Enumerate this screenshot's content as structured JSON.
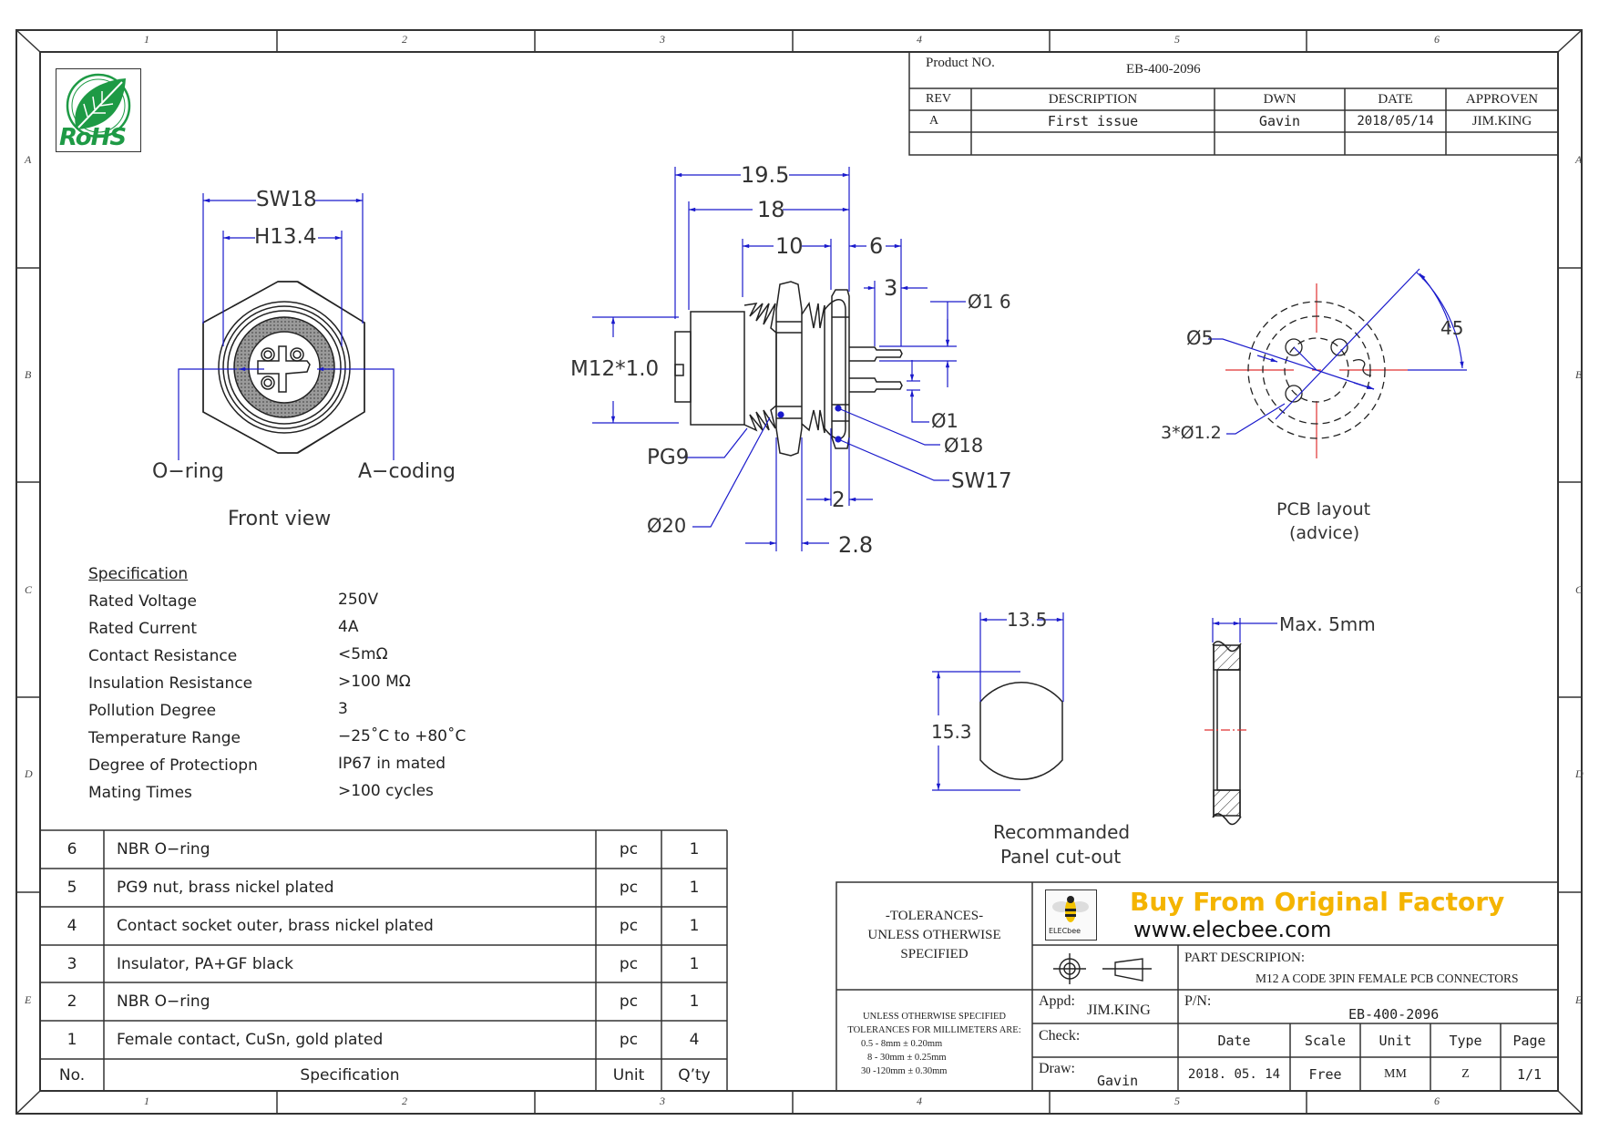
{
  "sheet": {
    "zones_top": [
      "1",
      "2",
      "3",
      "4",
      "5",
      "6"
    ],
    "zones_bottom": [
      "1",
      "2",
      "3",
      "4",
      "5",
      "6"
    ],
    "zones_left": [
      "A",
      "B",
      "C",
      "D",
      "E"
    ],
    "zones_right": [
      "A",
      "B",
      "C",
      "D",
      "E"
    ]
  },
  "logo": {
    "rohs_text": "RoHS",
    "icon": "rohs-leaf-icon"
  },
  "revision_block": {
    "product_no_label": "Product NO.",
    "product_no": "EB-400-2096",
    "headers": [
      "REV",
      "DESCRIPTION",
      "DWN",
      "DATE",
      "APPROVEN"
    ],
    "rows": [
      [
        "A",
        "First issue",
        "Gavin",
        "2018/05/14",
        "JIM.KING"
      ]
    ]
  },
  "front_view": {
    "dim_sw": "SW18",
    "dim_h": "H13.4",
    "label_oring": "O−ring",
    "label_coding": "A−coding",
    "caption": "Front  view"
  },
  "side_view": {
    "dim_overall": "19.5",
    "dim_body": "18",
    "dim_thread": "10",
    "dim_pins": "6",
    "dim_pin_tip": "3",
    "dim_pin_pitch": "Ø1 6",
    "dim_pin_dia": "Ø1",
    "dim_flange": "Ø18",
    "dim_sw": "SW17",
    "dim_thread_spec": "M12*1.0",
    "dim_pg": "PG9",
    "dim_nut_dia": "Ø20",
    "dim_flange_thk": "2",
    "dim_nut_thk": "2.8"
  },
  "pcb_layout": {
    "dim_circle": "Ø5",
    "dim_holes": "3*Ø1.2",
    "dim_angle": "45",
    "caption_1": "PCB layout",
    "caption_2": "(advice)"
  },
  "panel_cutout": {
    "dim_width": "13.5",
    "dim_height": "15.3",
    "caption_1": "Recommanded",
    "caption_2": "Panel cut-out",
    "dim_max": "Max. 5mm"
  },
  "specification": {
    "title": "Specification",
    "rows": [
      [
        "Rated  Voltage",
        "250V"
      ],
      [
        "Rated  Current",
        "4A"
      ],
      [
        "Contact  Resistance",
        "<5mΩ"
      ],
      [
        "Insulation  Resistance",
        ">100  MΩ"
      ],
      [
        "Pollution  Degree",
        "3"
      ],
      [
        "Temperature  Range",
        "−25˚C  to  +80˚C"
      ],
      [
        "Degree  of  Protectiopn",
        "IP67  in  mated"
      ],
      [
        "Mating  Times",
        " >100  cycles"
      ]
    ]
  },
  "bom": {
    "headers": [
      "No.",
      "Specification",
      "Unit",
      "Q’ty"
    ],
    "rows": [
      [
        "6",
        "NBR  O−ring",
        "pc",
        "1"
      ],
      [
        "5",
        "PG9  nut,  brass  nickel  plated",
        "pc",
        "1"
      ],
      [
        "4",
        "Contact  socket  outer,  brass  nickel  plated",
        "pc",
        "1"
      ],
      [
        "3",
        "Insulator,  PA+GF  black",
        "pc",
        "1"
      ],
      [
        "2",
        "NBR  O−ring",
        "pc",
        "1"
      ],
      [
        "1",
        "Female  contact,  CuSn,  gold  plated",
        "pc",
        "4"
      ]
    ]
  },
  "title_block": {
    "tolerances_title_1": "-TOLERANCES-",
    "tolerances_title_2": "UNLESS OTHERWISE",
    "tolerances_title_3": "SPECIFIED",
    "tol_lines": [
      "UNLESS OTHERWISE SPECIFIED",
      "TOLERANCES FOR MILLIMETERS ARE:",
      "0.5 - 8mm ± 0.20mm",
      "8 - 30mm ± 0.25mm",
      "30 -120mm ± 0.30mm"
    ],
    "brand_logo_text": "ELECbee",
    "brand_slogan": "Buy From Original Factory",
    "brand_url": "www.elecbee.com",
    "brand_color": "#f4b400",
    "projection_icon": "first-angle-projection-icon",
    "part_desc_label": "PART DESCRIPION:",
    "part_desc": "M12 A CODE 3PIN FEMALE  PCB CONNECTORS",
    "appd_label": "Appd:",
    "appd_value": "JIM.KING",
    "check_label": "Check:",
    "check_value": "",
    "draw_label": "Draw:",
    "draw_value": "Gavin",
    "pn_label": "P/N:",
    "pn_value": "EB-400-2096",
    "info_headers": [
      "Date",
      "Scale",
      "Unit",
      "Type",
      "Page"
    ],
    "info_values": [
      "2018. 05. 14",
      "Free",
      "MM",
      "Z",
      "1/1"
    ]
  },
  "colors": {
    "dimension": "#1a1acc",
    "centerline": "#e03030",
    "outline": "#222222",
    "rohs_green": "#1e9a45"
  }
}
